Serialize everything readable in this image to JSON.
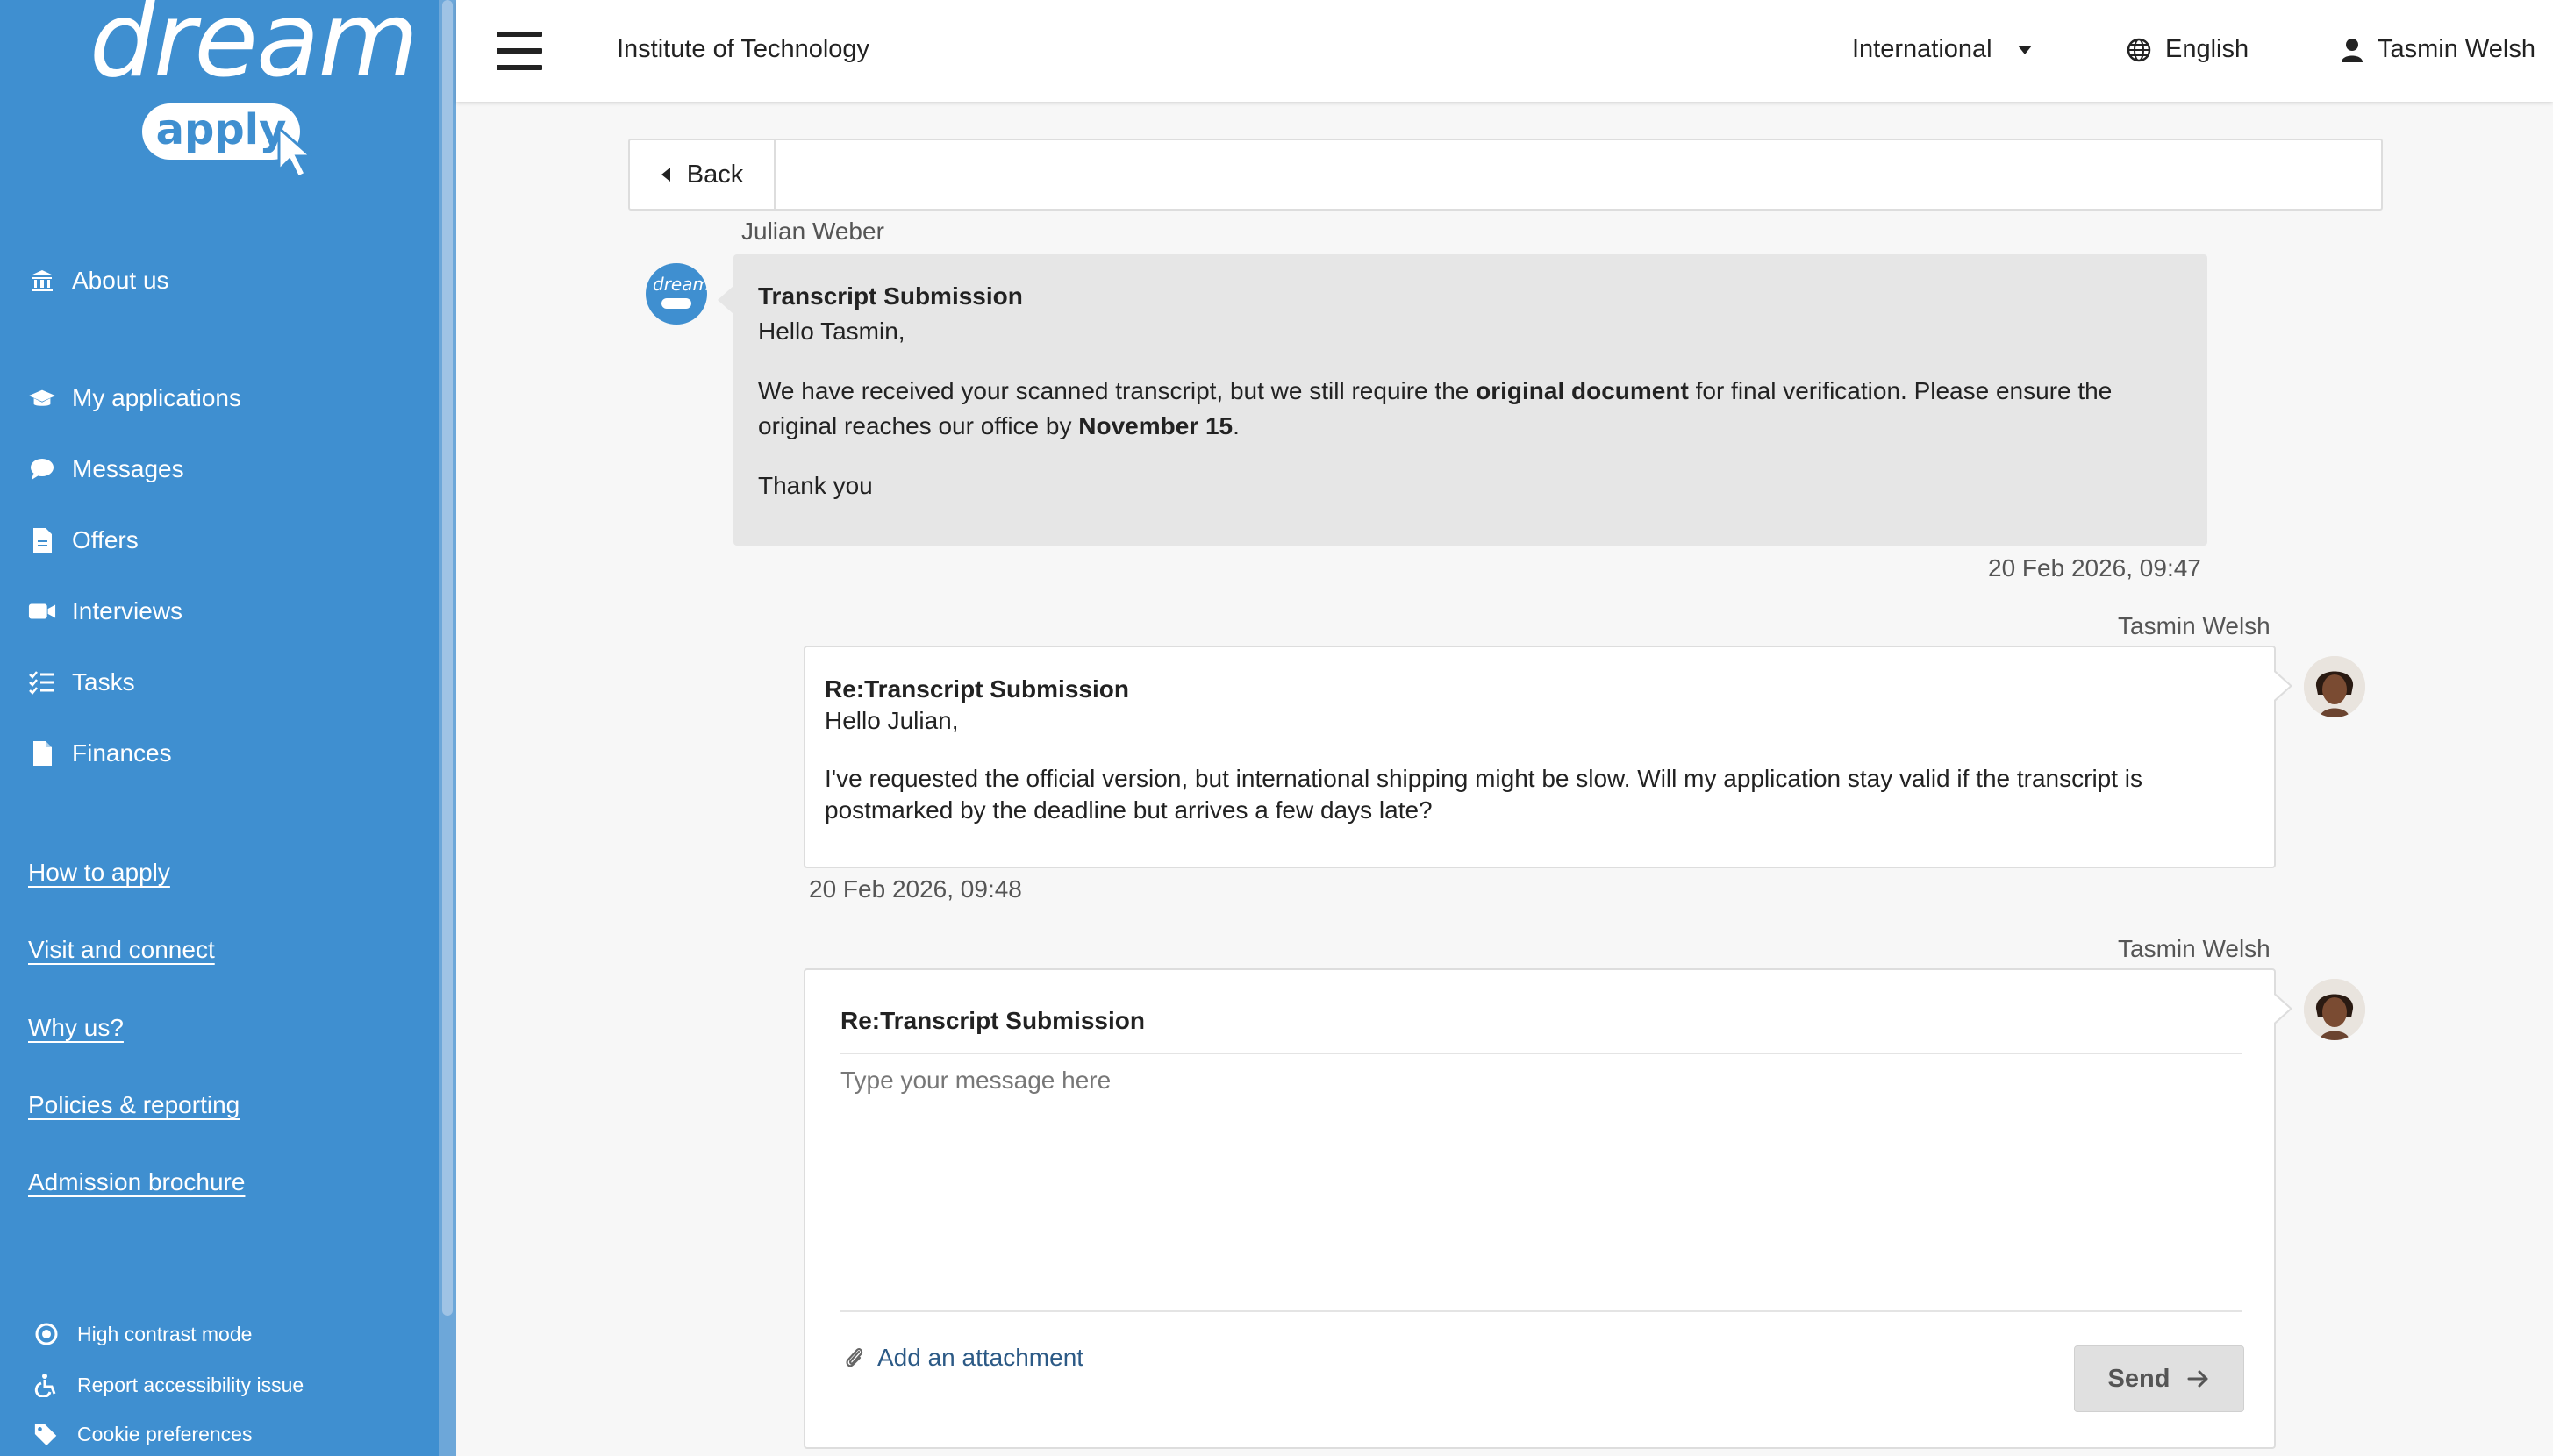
{
  "brand": {
    "logo_word": "dream",
    "logo_sub": "apply"
  },
  "sidebar": {
    "nav": [
      {
        "label": "About us",
        "icon": "institution-icon"
      },
      {
        "label": "My applications",
        "icon": "graduation-cap-icon"
      },
      {
        "label": "Messages",
        "icon": "speech-bubble-icon"
      },
      {
        "label": "Offers",
        "icon": "document-icon"
      },
      {
        "label": "Interviews",
        "icon": "video-camera-icon"
      },
      {
        "label": "Tasks",
        "icon": "checklist-icon"
      },
      {
        "label": "Finances",
        "icon": "document-icon"
      }
    ],
    "links": [
      "How to apply",
      "Visit and connect",
      "Why us?",
      "Policies & reporting",
      "Admission brochure"
    ],
    "footer": [
      {
        "label": "High contrast mode",
        "icon": "contrast-icon"
      },
      {
        "label": "Report accessibility issue",
        "icon": "wheelchair-icon"
      },
      {
        "label": "Cookie preferences",
        "icon": "tags-icon"
      }
    ]
  },
  "topbar": {
    "institution": "Institute of Technology",
    "region": "International",
    "language": "English",
    "user_name": "Tasmin Welsh"
  },
  "thread": {
    "back_label": "Back",
    "incoming": {
      "sender": "Julian Weber",
      "subject": "Transcript Submission",
      "greeting": "Hello Tasmin,",
      "body_before": "We have received your scanned transcript, but we still require the ",
      "body_bold1": "original document",
      "body_middle": " for final verification. Please ensure the original reaches our office by ",
      "body_bold2": "November 15",
      "body_end": ".",
      "closing": "Thank you",
      "timestamp": "20 Feb 2026, 09:47"
    },
    "reply": {
      "sender": "Tasmin Welsh",
      "subject": "Re:Transcript Submission",
      "greeting": "Hello Julian,",
      "body": "I've requested the official version, but international shipping might be slow. Will my application stay valid if the transcript is postmarked by the deadline but arrives a few days late?",
      "timestamp": "20 Feb 2026, 09:48"
    },
    "compose": {
      "sender": "Tasmin Welsh",
      "subject": "Re:Transcript Submission",
      "placeholder": "Type your message here",
      "attach_label": "Add an attachment",
      "send_label": "Send"
    }
  },
  "colors": {
    "sidebar": "#3f8fd0",
    "incoming_bubble": "#e6e6e6",
    "link": "#2c5a86"
  }
}
